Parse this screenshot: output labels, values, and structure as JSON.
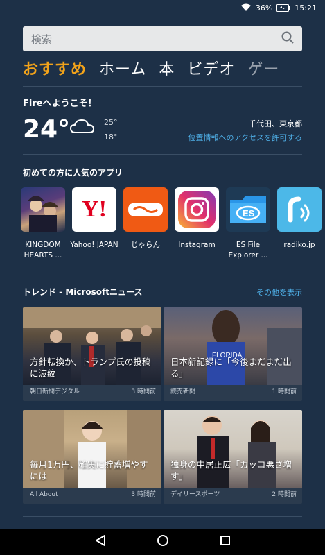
{
  "status": {
    "battery": "36%",
    "time": "15:21"
  },
  "search": {
    "placeholder": "検索"
  },
  "tabs": [
    {
      "label": "おすすめ",
      "active": true
    },
    {
      "label": "ホーム"
    },
    {
      "label": "本"
    },
    {
      "label": "ビデオ"
    },
    {
      "label": "ゲー"
    }
  ],
  "welcome": {
    "title": "Fireへようこそ！",
    "temperature": "24°",
    "high": "25°",
    "low": "18°",
    "location": "千代田、東京都",
    "location_link": "位置情報へのアクセスを許可する",
    "weather_icon": "cloud-icon"
  },
  "apps_section": {
    "title": "初めての方に人気のアプリ",
    "apps": [
      {
        "label": "KINGDOM HEARTS ...",
        "icon": "kingdom-hearts-icon"
      },
      {
        "label": "Yahoo! JAPAN",
        "icon": "yahoo-japan-icon"
      },
      {
        "label": "じゃらん",
        "icon": "jalan-icon"
      },
      {
        "label": "Instagram",
        "icon": "instagram-icon"
      },
      {
        "label": "ES File Explorer ...",
        "icon": "es-file-explorer-icon"
      },
      {
        "label": "radiko.jp",
        "icon": "radiko-icon"
      }
    ]
  },
  "trend": {
    "title": "トレンド - Microsoftニュース",
    "more": "その他を表示",
    "cards": [
      {
        "headline": "方針転換か、トランプ氏の投稿に波紋",
        "source": "朝日新聞デジタル",
        "time": "3 時間前"
      },
      {
        "headline": "日本新記録に「今後まだまだ出る」",
        "source": "読売新聞",
        "time": "1 時間前"
      },
      {
        "headline": "毎月1万円、確実に貯蓄増やすには",
        "source": "All About",
        "time": "3 時間前"
      },
      {
        "headline": "独身の中居正広「カッコ悪さ増す」",
        "source": "デイリースポーツ",
        "time": "2 時間前"
      }
    ]
  },
  "colors": {
    "background": "#1d3047",
    "accent": "#f2a31a",
    "link": "#4fb0e8"
  }
}
